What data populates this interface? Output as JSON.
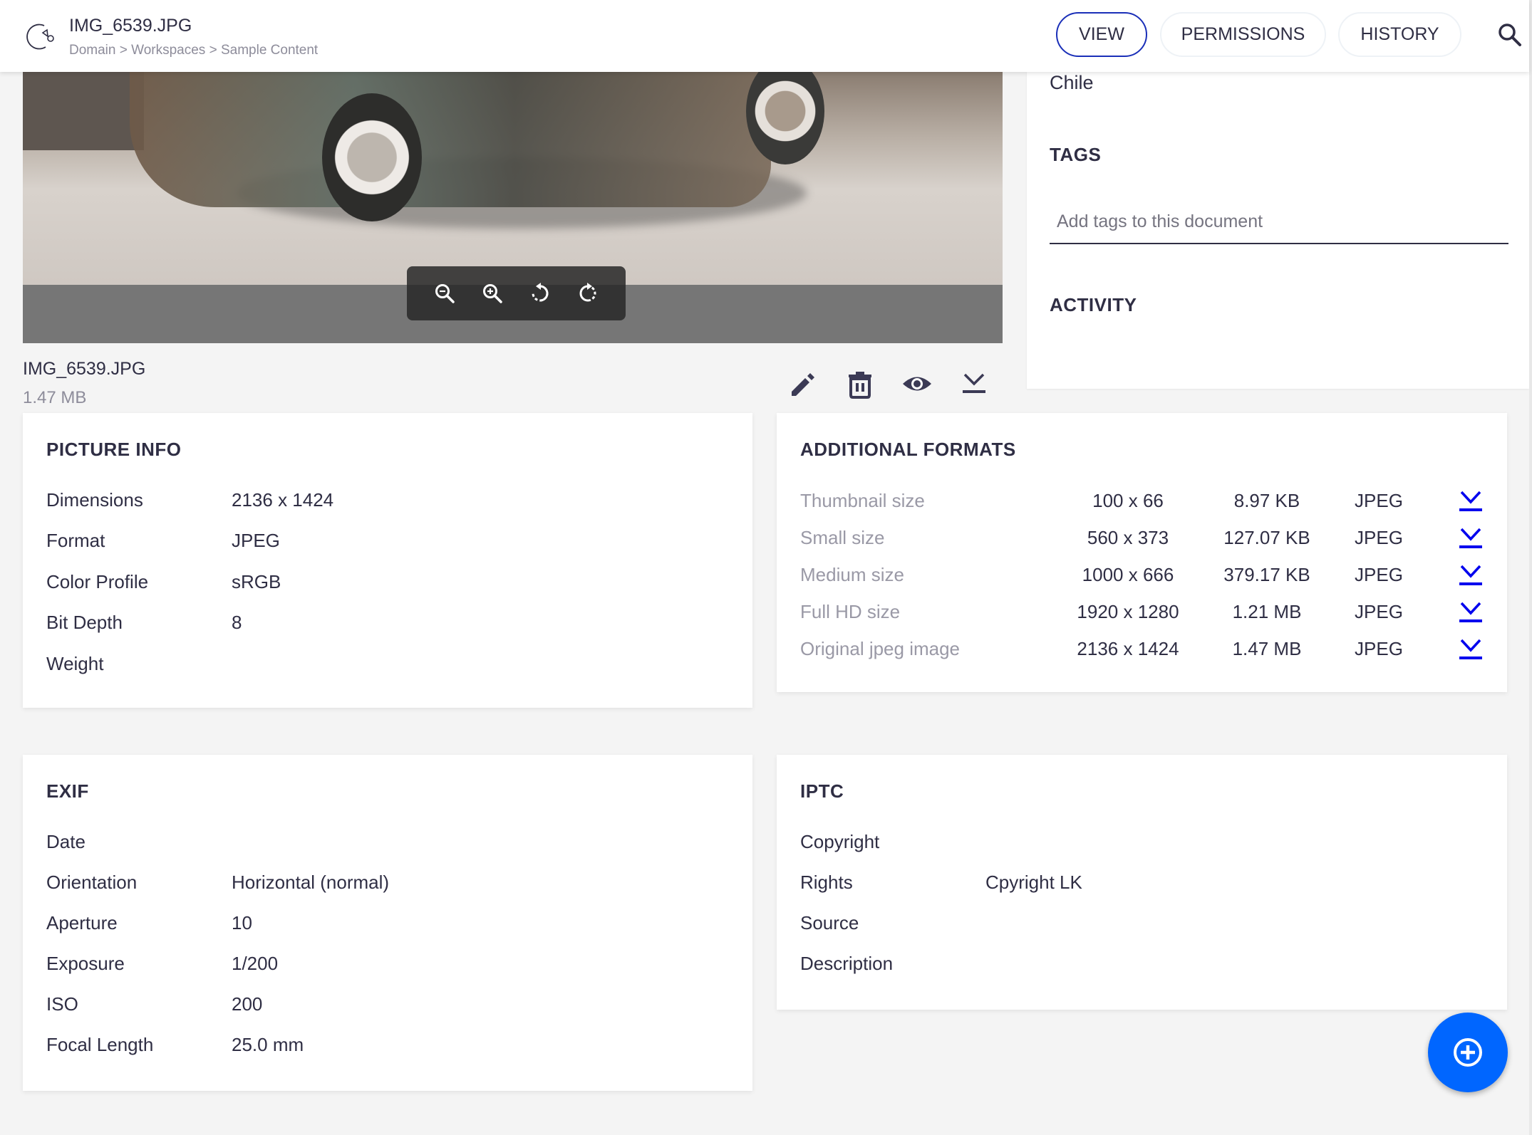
{
  "header": {
    "title": "IMG_6539.JPG",
    "breadcrumb": "Domain > Workspaces > Sample Content",
    "tabs": [
      {
        "label": "VIEW",
        "active": true
      },
      {
        "label": "PERMISSIONS",
        "active": false
      },
      {
        "label": "HISTORY",
        "active": false
      }
    ]
  },
  "viewer": {
    "tools": [
      "zoom-out",
      "zoom-in",
      "rotate-left",
      "rotate-right"
    ]
  },
  "file": {
    "name": "IMG_6539.JPG",
    "size": "1.47 MB",
    "actions": [
      "edit",
      "delete",
      "preview",
      "download"
    ]
  },
  "side": {
    "country": "Chile",
    "tags_heading": "TAGS",
    "tags_placeholder": "Add tags to this document",
    "activity_heading": "ACTIVITY"
  },
  "picture_info": {
    "title": "PICTURE INFO",
    "rows": [
      {
        "label": "Dimensions",
        "value": "2136 x 1424"
      },
      {
        "label": "Format",
        "value": "JPEG"
      },
      {
        "label": "Color Profile",
        "value": "sRGB"
      },
      {
        "label": "Bit Depth",
        "value": "8"
      },
      {
        "label": "Weight",
        "value": ""
      }
    ]
  },
  "additional_formats": {
    "title": "ADDITIONAL FORMATS",
    "rows": [
      {
        "name": "Thumbnail size",
        "dimensions": "100 x 66",
        "size": "8.97 KB",
        "type": "JPEG"
      },
      {
        "name": "Small size",
        "dimensions": "560 x 373",
        "size": "127.07 KB",
        "type": "JPEG"
      },
      {
        "name": "Medium size",
        "dimensions": "1000 x 666",
        "size": "379.17 KB",
        "type": "JPEG"
      },
      {
        "name": "Full HD size",
        "dimensions": "1920 x 1280",
        "size": "1.21 MB",
        "type": "JPEG"
      },
      {
        "name": "Original jpeg image",
        "dimensions": "2136 x 1424",
        "size": "1.47 MB",
        "type": "JPEG"
      }
    ]
  },
  "exif": {
    "title": "EXIF",
    "rows": [
      {
        "label": "Date",
        "value": ""
      },
      {
        "label": "Orientation",
        "value": "Horizontal (normal)"
      },
      {
        "label": "Aperture",
        "value": "10"
      },
      {
        "label": "Exposure",
        "value": "1/200"
      },
      {
        "label": "ISO",
        "value": "200"
      },
      {
        "label": "Focal Length",
        "value": "25.0 mm"
      }
    ]
  },
  "iptc": {
    "title": "IPTC",
    "rows": [
      {
        "label": "Copyright",
        "value": ""
      },
      {
        "label": "Rights",
        "value": "Cpyright LK"
      },
      {
        "label": "Source",
        "value": ""
      },
      {
        "label": "Description",
        "value": ""
      }
    ]
  },
  "colors": {
    "accent": "#1a2fb8",
    "fab": "#0066ff",
    "download_link": "#0000ee",
    "text": "#2f2e44",
    "muted": "#8d8c9a"
  }
}
